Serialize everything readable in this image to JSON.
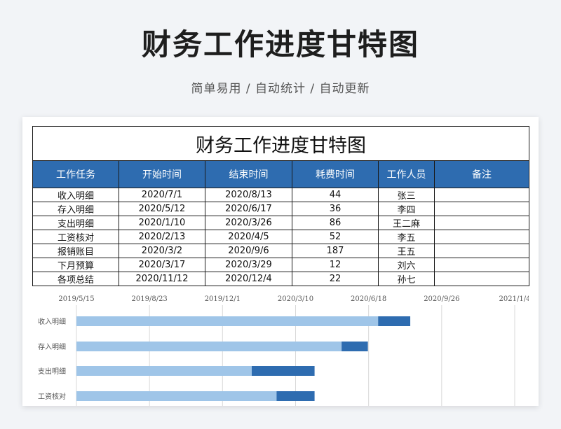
{
  "hero": {
    "title": "财务工作进度甘特图",
    "subtitle": "简单易用 / 自动统计 / 自动更新"
  },
  "sheet": {
    "title": "财务工作进度甘特图",
    "headers": [
      "工作任务",
      "开始时间",
      "结束时间",
      "耗费时间",
      "工作人员",
      "备注"
    ],
    "rows": [
      [
        "收入明细",
        "2020/7/1",
        "2020/8/13",
        "44",
        "张三",
        ""
      ],
      [
        "存入明细",
        "2020/5/12",
        "2020/6/17",
        "36",
        "李四",
        ""
      ],
      [
        "支出明细",
        "2020/1/10",
        "2020/3/26",
        "86",
        "王二麻",
        ""
      ],
      [
        "工资核对",
        "2020/2/13",
        "2020/4/5",
        "52",
        "李五",
        ""
      ],
      [
        "报销账目",
        "2020/3/2",
        "2020/9/6",
        "187",
        "王五",
        ""
      ],
      [
        "下月预算",
        "2020/3/17",
        "2020/3/29",
        "12",
        "刘六",
        ""
      ],
      [
        "各项总结",
        "2020/11/12",
        "2020/12/4",
        "22",
        "孙七",
        ""
      ]
    ]
  },
  "chart_data": {
    "type": "bar",
    "orientation": "horizontal-stacked",
    "x_ticks": [
      "2019/5/15",
      "2019/8/23",
      "2019/12/1",
      "2020/3/10",
      "2020/6/18",
      "2020/9/26",
      "2021/1/4"
    ],
    "xlim": [
      "2019/5/15",
      "2021/1/4"
    ],
    "categories": [
      "收入明细",
      "存入明细",
      "支出明细",
      "工资核对"
    ],
    "start_dates": [
      "2020/7/1",
      "2020/5/12",
      "2020/1/10",
      "2020/2/13"
    ],
    "durations": [
      44,
      36,
      86,
      52
    ],
    "grid": true,
    "colors": {
      "offset": "#9fc5e8",
      "duration": "#2e6cb0",
      "grid": "#d9d9d9"
    }
  }
}
